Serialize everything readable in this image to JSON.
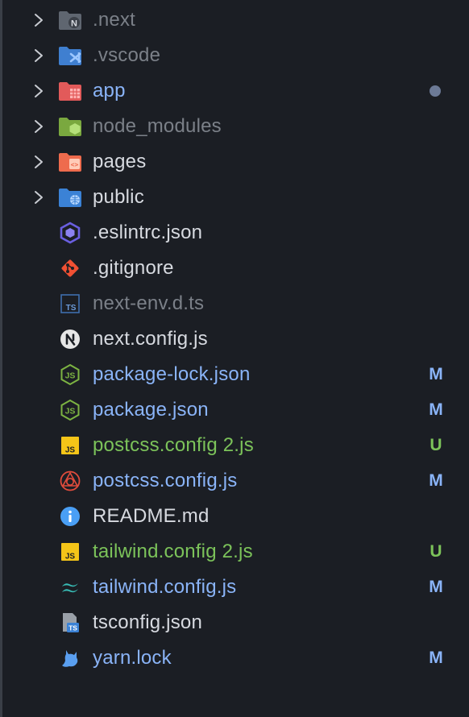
{
  "items": [
    {
      "label": ".next",
      "type": "folder",
      "icon": "next-folder-icon",
      "color_class": "c-dim"
    },
    {
      "label": ".vscode",
      "type": "folder",
      "icon": "vscode-folder-icon",
      "color_class": "c-dim"
    },
    {
      "label": "app",
      "type": "folder",
      "icon": "app-folder-icon",
      "color_class": "c-blue",
      "dot": true
    },
    {
      "label": "node_modules",
      "type": "folder",
      "icon": "node-modules-folder-icon",
      "color_class": "c-dim"
    },
    {
      "label": "pages",
      "type": "folder",
      "icon": "pages-folder-icon",
      "color_class": "c-white"
    },
    {
      "label": "public",
      "type": "folder",
      "icon": "public-folder-icon",
      "color_class": "c-white"
    },
    {
      "label": ".eslintrc.json",
      "type": "file",
      "icon": "eslint-icon",
      "color_class": "c-white"
    },
    {
      "label": ".gitignore",
      "type": "file",
      "icon": "git-icon",
      "color_class": "c-white"
    },
    {
      "label": "next-env.d.ts",
      "type": "file",
      "icon": "typescript-icon",
      "color_class": "c-dim"
    },
    {
      "label": "next.config.js",
      "type": "file",
      "icon": "nextjs-icon",
      "color_class": "c-white"
    },
    {
      "label": "package-lock.json",
      "type": "file",
      "icon": "nodejs-icon",
      "color_class": "c-blue",
      "badge": "M"
    },
    {
      "label": "package.json",
      "type": "file",
      "icon": "nodejs-icon",
      "color_class": "c-blue",
      "badge": "M"
    },
    {
      "label": "postcss.config 2.js",
      "type": "file",
      "icon": "javascript-icon",
      "color_class": "c-green",
      "badge": "U"
    },
    {
      "label": "postcss.config.js",
      "type": "file",
      "icon": "postcss-icon",
      "color_class": "c-blue",
      "badge": "M"
    },
    {
      "label": "README.md",
      "type": "file",
      "icon": "info-icon",
      "color_class": "c-white"
    },
    {
      "label": "tailwind.config 2.js",
      "type": "file",
      "icon": "javascript-icon",
      "color_class": "c-green",
      "badge": "U"
    },
    {
      "label": "tailwind.config.js",
      "type": "file",
      "icon": "tailwind-icon",
      "color_class": "c-blue",
      "badge": "M"
    },
    {
      "label": "tsconfig.json",
      "type": "file",
      "icon": "tsconfig-icon",
      "color_class": "c-white"
    },
    {
      "label": "yarn.lock",
      "type": "file",
      "icon": "yarn-icon",
      "color_class": "c-blue",
      "badge": "M"
    }
  ],
  "colors": {
    "background": "#1b1e24",
    "modified": "#8ab4f8",
    "untracked": "#7cc35a",
    "dimmed": "#7b8088",
    "dot": "#6c7a96"
  }
}
